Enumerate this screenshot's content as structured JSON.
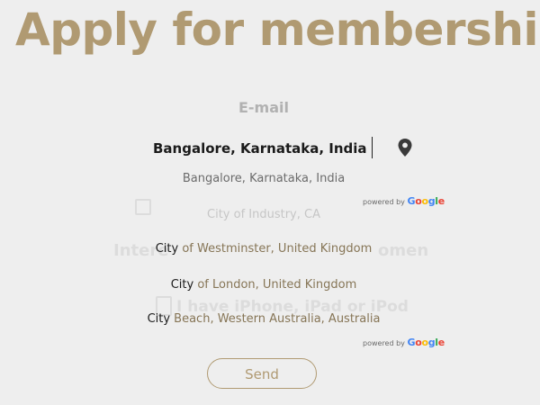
{
  "header": {
    "title": "Apply for membership"
  },
  "form": {
    "email_label": "E-mail",
    "location_input": {
      "value": "Bangalore, Karnataka, India",
      "icon": "map-pin-icon"
    },
    "background_faded": {
      "checkbox_text": "City of Industry, CA",
      "label_left": "Intere",
      "label_right": "omen",
      "device_text": "I have iPhone, iPad or iPod"
    },
    "send_label": "Send"
  },
  "autocomplete": {
    "groups": [
      {
        "suggestions": [
          {
            "main": "",
            "rest": "Bangalore, Karnataka, India"
          },
          {
            "main": "",
            "rest": "City of Industry, CA"
          }
        ],
        "attribution": {
          "prefix": "powered by",
          "brand": "Google"
        }
      },
      {
        "suggestions": [
          {
            "main": "City",
            "rest": " of Westminster, United Kingdom"
          },
          {
            "main": "City",
            "rest": " of London, United Kingdom"
          },
          {
            "main": "City",
            "rest": " Beach, Western Australia, Australia"
          }
        ],
        "attribution": {
          "prefix": "powered by",
          "brand": "Google"
        }
      }
    ]
  },
  "colors": {
    "accent_gold": "#b09a72",
    "google_blue": "#4285f4",
    "google_red": "#ea4335",
    "google_yellow": "#fbbc05",
    "google_green": "#34a853"
  }
}
